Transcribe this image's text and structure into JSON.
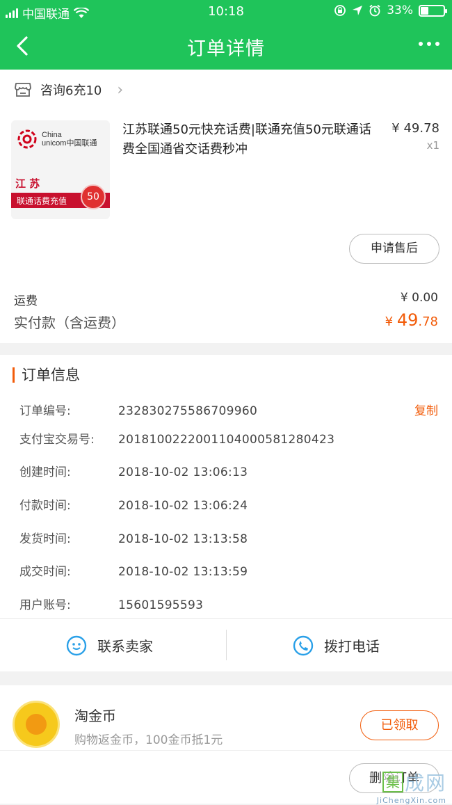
{
  "status_bar": {
    "carrier": "中国联通",
    "time": "10:18",
    "battery": "33%",
    "battery_level": 0.33
  },
  "nav": {
    "title": "订单详情"
  },
  "shop": {
    "name": "咨询6充10"
  },
  "product": {
    "image_logo_text_1": "China",
    "image_logo_text_2": "unicom中国联通",
    "image_province": "江 苏",
    "image_band": "联通话费充值",
    "image_badge": "50",
    "title": "江苏联通50元快充话费|联通充值50元联通话费全国通省交话费秒冲",
    "price": "¥ 49.78",
    "qty": "x1",
    "after_sale_label": "申请售后"
  },
  "totals": {
    "shipping_label": "运费",
    "shipping_value": "¥ 0.00",
    "paid_label": "实付款（含运费）",
    "paid_currency": "¥ ",
    "paid_int": "49",
    "paid_dec": ".78"
  },
  "order_info": {
    "title": "订单信息",
    "copy_label": "复制",
    "rows": [
      {
        "k": "订单编号:",
        "v": "232830275586709960"
      },
      {
        "k": "支付宝交易号:",
        "v": "2018100222001104000581280423"
      },
      {
        "k": "创建时间:",
        "v": "2018-10-02 13:06:13"
      },
      {
        "k": "付款时间:",
        "v": "2018-10-02 13:06:24"
      },
      {
        "k": "发货时间:",
        "v": "2018-10-02 13:13:58"
      },
      {
        "k": "成交时间:",
        "v": "2018-10-02 13:13:59"
      },
      {
        "k": "用户账号:",
        "v": "15601595593"
      }
    ]
  },
  "actions": {
    "contact_seller": "联系卖家",
    "call_phone": "拨打电话"
  },
  "coins": {
    "title": "淘金币",
    "subtitle": "购物返金币，100金币抵1元",
    "claim_label": "已领取"
  },
  "footer": {
    "delete_label": "删除订单"
  },
  "watermark": {
    "box": "集",
    "text": "成网",
    "url": "JiChengXin.com"
  }
}
